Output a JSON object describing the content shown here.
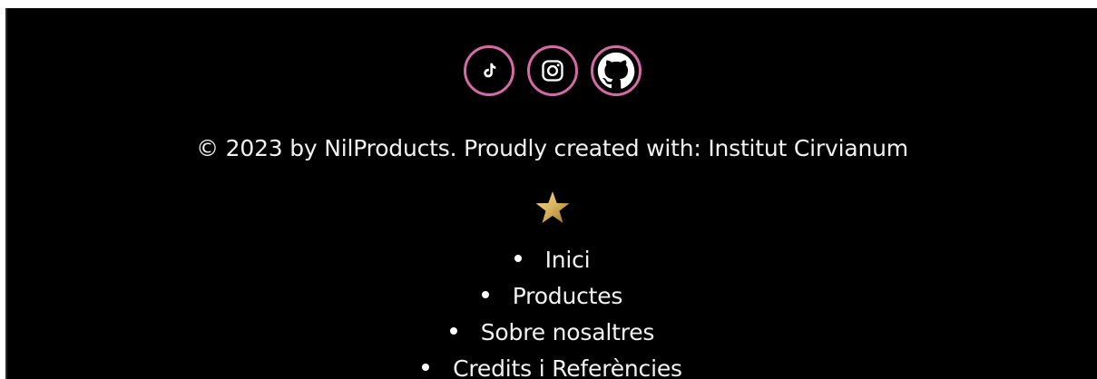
{
  "colors": {
    "background": "#000000",
    "text": "#f2f2f2",
    "accent_pink": "#d46aa6",
    "star_gold": "#d9b25c"
  },
  "social": [
    {
      "icon": "tiktok-icon"
    },
    {
      "icon": "instagram-icon"
    },
    {
      "icon": "github-icon"
    }
  ],
  "footer": {
    "copyright": "© 2023 by NilProducts. Proudly created with: Institut Cirvianum",
    "star_icon": "star-icon"
  },
  "nav": {
    "items": [
      {
        "label": "Inici"
      },
      {
        "label": "Productes"
      },
      {
        "label": "Sobre nosaltres"
      },
      {
        "label": "Credits i Referències"
      }
    ]
  }
}
